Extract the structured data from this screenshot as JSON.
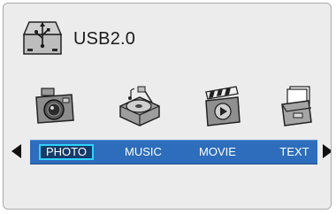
{
  "device": {
    "label": "USB2.0",
    "icon": "usb-drive-icon"
  },
  "menu": {
    "items": [
      {
        "label": "PHOTO",
        "icon": "camera-icon",
        "selected": true
      },
      {
        "label": "MUSIC",
        "icon": "record-player-icon",
        "selected": false
      },
      {
        "label": "MOVIE",
        "icon": "clapperboard-icon",
        "selected": false
      },
      {
        "label": "TEXT",
        "icon": "document-tray-icon",
        "selected": false
      }
    ]
  },
  "navigation": {
    "left_icon": "left-arrow-icon",
    "right_icon": "right-arrow-icon"
  },
  "colors": {
    "background": "#ececec",
    "menu_bar": "#2d6dbc",
    "selection_fill": "#163b68",
    "selection_border": "#2fd1ff"
  }
}
